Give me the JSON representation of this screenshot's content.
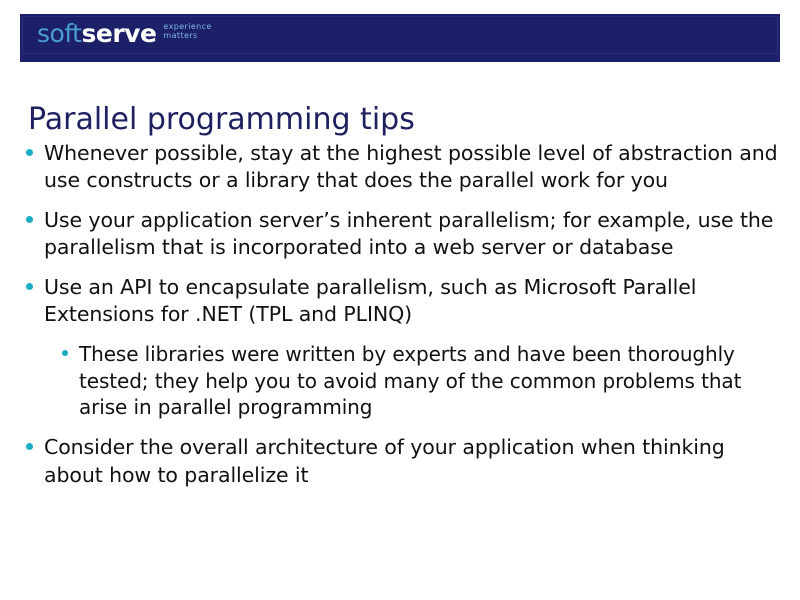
{
  "slide": {
    "title": "Parallel programming tips",
    "colors": {
      "banner_navy": "#1b2068",
      "title_navy": "#1f2060",
      "bullet_teal": "#1aaec6",
      "logo_soft_blue": "#4a9ed6",
      "logo_serve_white": "#ffffff",
      "tagline_blue": "#7fb9e0",
      "body_text": "#111111",
      "background": "#ffffff"
    }
  },
  "logo": {
    "word_soft": "soft",
    "word_serve": "serve",
    "tagline_line1": "experience",
    "tagline_line2": "matters"
  },
  "bullets": [
    {
      "level": 1,
      "text": "Whenever possible, stay at the highest possible level of abstraction and use constructs or a library that does the parallel work for you"
    },
    {
      "level": 1,
      "text": "Use your application server’s inherent parallelism; for example, use the parallelism that is incorporated into a web server or database"
    },
    {
      "level": 1,
      "text": "Use an API to encapsulate parallelism, such as Microsoft Parallel Extensions for .NET (TPL and PLINQ)"
    },
    {
      "level": 2,
      "text": "These libraries were written by experts and have been thoroughly tested; they help you to avoid many of the common problems that arise in parallel programming"
    },
    {
      "level": 1,
      "text": "Consider the overall architecture of your application when thinking about how to parallelize it"
    }
  ]
}
